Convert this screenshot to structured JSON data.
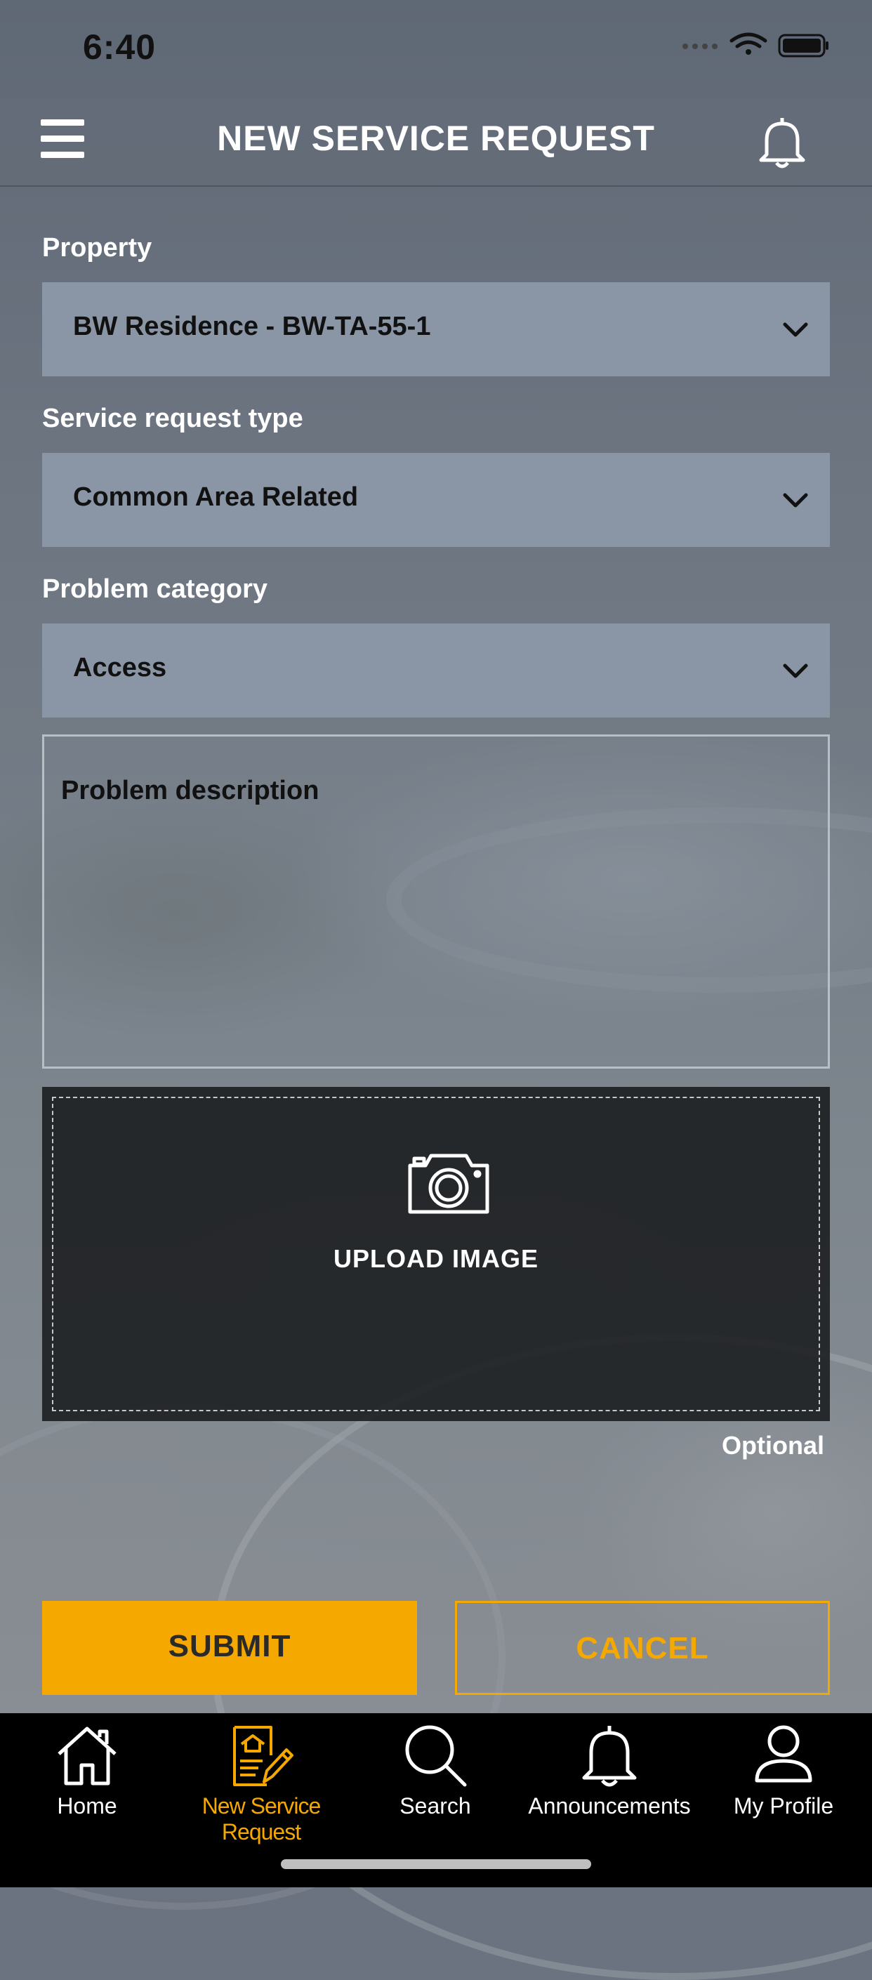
{
  "status_bar": {
    "time": "6:40"
  },
  "header": {
    "title": "NEW SERVICE REQUEST",
    "menu_icon": "hamburger-menu-icon",
    "bell_icon": "bell-icon"
  },
  "form": {
    "property": {
      "label": "Property",
      "value": "BW Residence - BW-TA-55-1"
    },
    "request_type": {
      "label": "Service request type",
      "value": "Common Area Related"
    },
    "problem_category": {
      "label": "Problem category",
      "value": "Access"
    },
    "description": {
      "placeholder": "Problem description"
    },
    "upload": {
      "label": "UPLOAD IMAGE",
      "icon": "camera-icon",
      "note": "Optional"
    }
  },
  "actions": {
    "submit": "SUBMIT",
    "cancel": "CANCEL"
  },
  "tabbar": {
    "items": [
      {
        "label": "Home",
        "icon": "home-icon"
      },
      {
        "label": "New Service Request",
        "icon": "new-request-icon",
        "active": true
      },
      {
        "label": "Search",
        "icon": "search-icon"
      },
      {
        "label": "Announcements",
        "icon": "bell-icon"
      },
      {
        "label": "My Profile",
        "icon": "profile-icon"
      }
    ]
  },
  "colors": {
    "accent": "#f5a800",
    "select_bg": "#8a96a6",
    "tabbar_bg": "#000000"
  }
}
